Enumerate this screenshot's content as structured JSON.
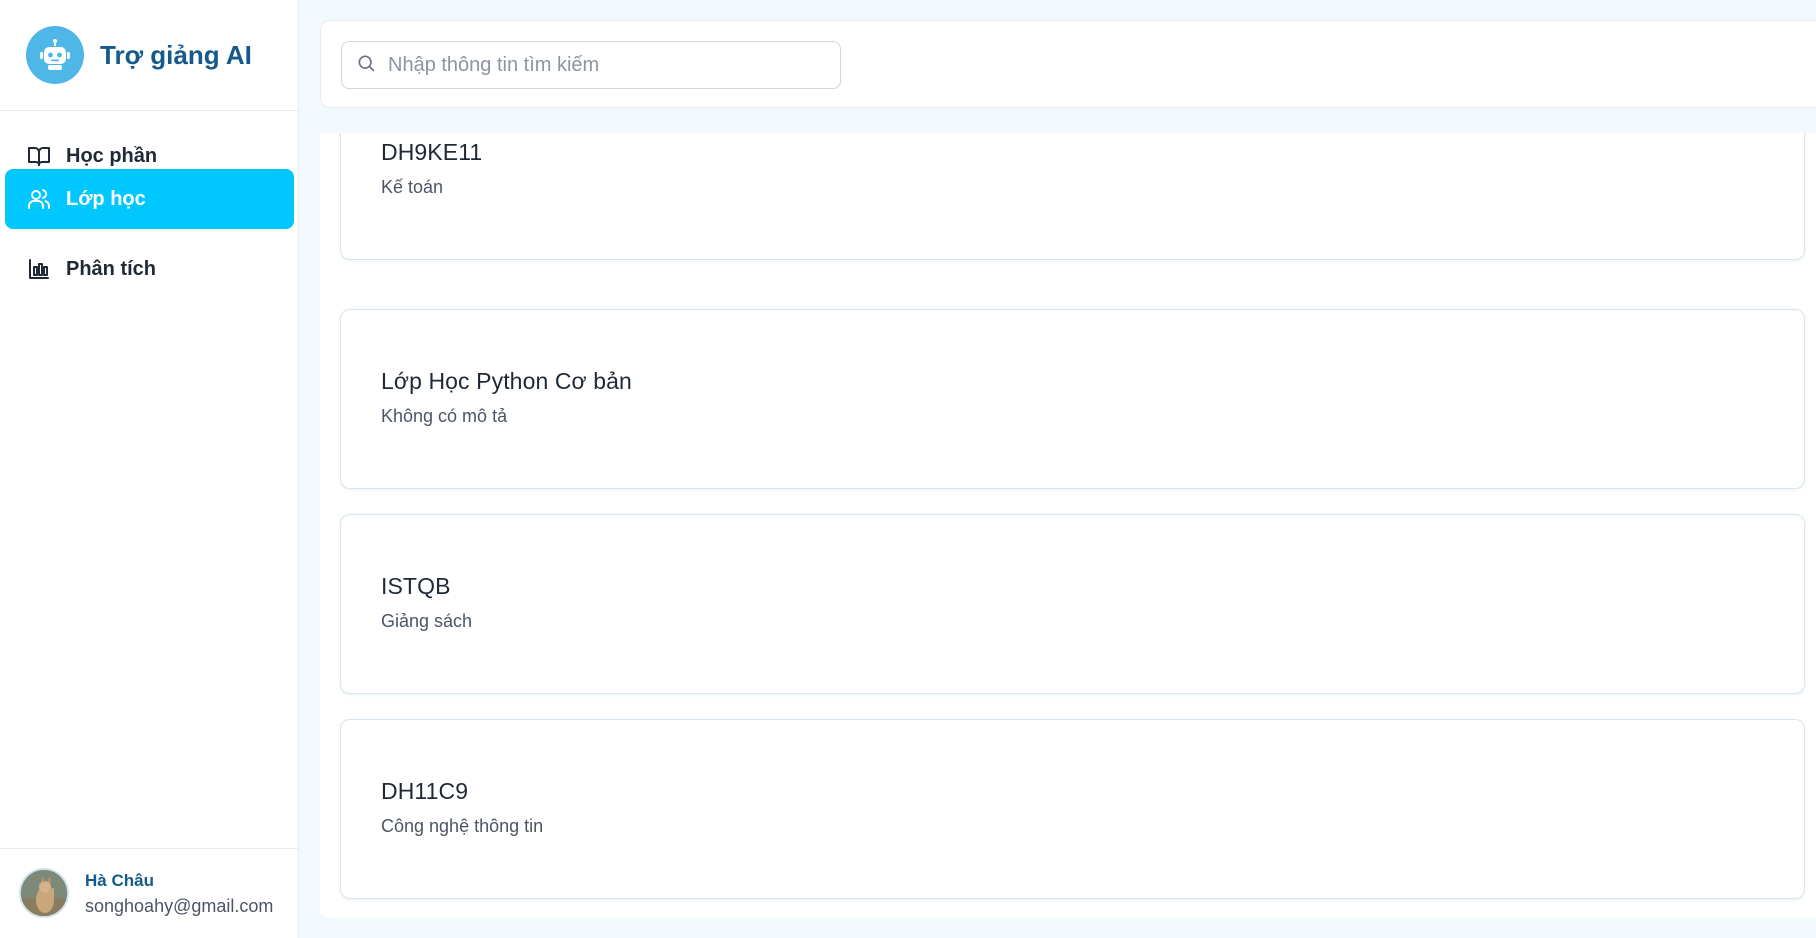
{
  "brand": {
    "title": "Trợ giảng AI",
    "logo_icon": "robot-icon",
    "accent": "#4fb6e8"
  },
  "nav": {
    "items": [
      {
        "label": "Học phần",
        "icon": "book-open-icon",
        "active": false
      },
      {
        "label": "Lớp học",
        "icon": "users-icon",
        "active": true
      },
      {
        "label": "Phân tích",
        "icon": "bar-chart-icon",
        "active": false
      }
    ],
    "active_color": "#00c8ff"
  },
  "user": {
    "name": "Hà Châu",
    "email": "songhoahy@gmail.com"
  },
  "search": {
    "placeholder": "Nhập thông tin tìm kiếm",
    "value": ""
  },
  "classes": [
    {
      "name": "DH9KE11",
      "description": "Kế toán"
    },
    {
      "name": "Lớp Học Python Cơ bản",
      "description": "Không có mô tả"
    },
    {
      "name": "ISTQB",
      "description": "Giảng sách"
    },
    {
      "name": "DH11C9",
      "description": "Công nghệ thông tin"
    }
  ]
}
